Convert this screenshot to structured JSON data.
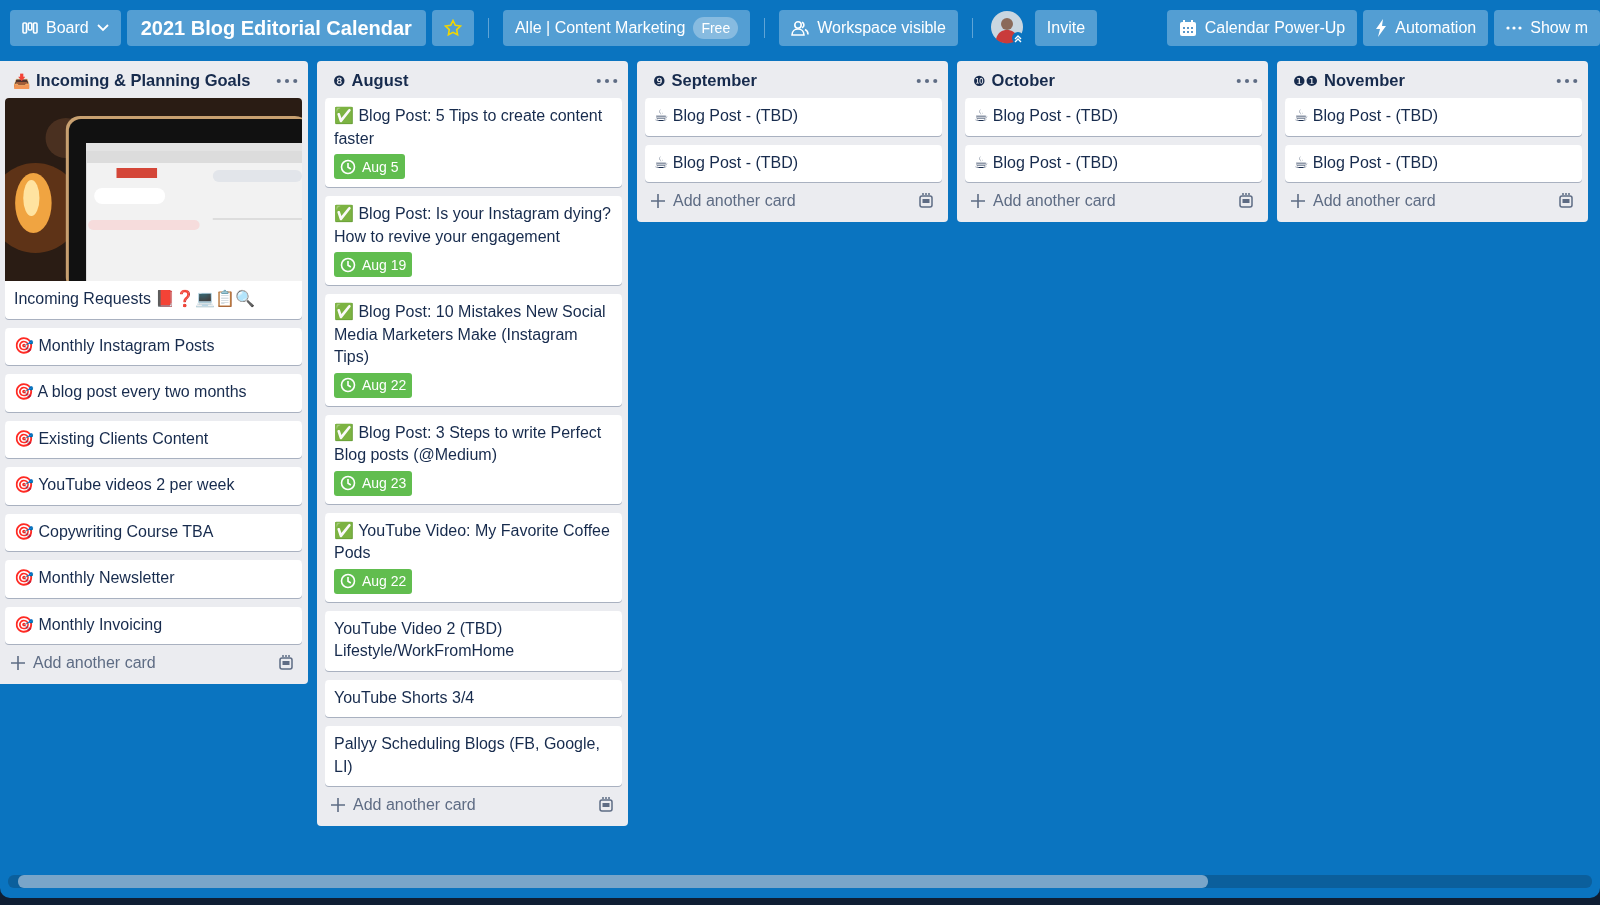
{
  "topbar": {
    "board_menu": "Board",
    "board_title": "2021 Blog Editorial Calendar",
    "starred": true,
    "workspace": "Alle | Content Marketing",
    "plan_badge": "Free",
    "visibility": "Workspace visible",
    "invite": "Invite",
    "actions": [
      {
        "kind": "calendar",
        "label": "Calendar Power-Up"
      },
      {
        "kind": "automation",
        "label": "Automation"
      },
      {
        "kind": "more",
        "label": "Show m"
      }
    ]
  },
  "lists": [
    {
      "mark": "📥",
      "title": "Incoming & Planning Goals",
      "add_card": "Add another card",
      "cards": [
        {
          "title": "Incoming Requests 📕❓💻📋🔍"
        },
        {
          "title": "🎯 Monthly Instagram Posts"
        },
        {
          "title": "🎯 A blog post every two months"
        },
        {
          "title": "🎯 Existing Clients Content"
        },
        {
          "title": "🎯 YouTube videos 2 per week"
        },
        {
          "title": "🎯 Copywriting Course TBA"
        },
        {
          "title": "🎯 Monthly Newsletter"
        },
        {
          "title": "🎯 Monthly Invoicing"
        }
      ]
    },
    {
      "mark": "❽",
      "title": "August",
      "add_card": "Add another card",
      "cards": [
        {
          "title": "✅ Blog Post: 5 Tips to create content faster",
          "due": {
            "date": "Aug 5",
            "complete": true
          }
        },
        {
          "title": "✅ Blog Post: Is your Instagram dying? How to revive your engagement",
          "due": {
            "date": "Aug 19",
            "complete": true
          }
        },
        {
          "title": "✅ Blog Post: 10 Mistakes New Social Media Marketers Make (Instagram Tips)",
          "due": {
            "date": "Aug 22",
            "complete": true
          }
        },
        {
          "title": "✅ Blog Post: 3 Steps to write Perfect Blog posts (@Medium)",
          "due": {
            "date": "Aug 23",
            "complete": true
          }
        },
        {
          "title": "✅ YouTube Video: My Favorite Coffee Pods",
          "due": {
            "date": "Aug 22",
            "complete": true
          }
        },
        {
          "title": "YouTube Video 2 (TBD) Lifestyle/WorkFromHome"
        },
        {
          "title": "YouTube Shorts 3/4"
        },
        {
          "title": "Pallyy Scheduling Blogs (FB, Google, LI)"
        }
      ]
    },
    {
      "mark": "❾",
      "title": "September",
      "add_card": "Add another card",
      "cards": [
        {
          "title": "☕ Blog Post - (TBD)"
        },
        {
          "title": "☕ Blog Post - (TBD)"
        }
      ]
    },
    {
      "mark": "❿",
      "title": "October",
      "add_card": "Add another card",
      "cards": [
        {
          "title": "☕ Blog Post - (TBD)"
        },
        {
          "title": "☕ Blog Post - (TBD)"
        }
      ]
    },
    {
      "mark": "❶❶",
      "title": "November",
      "add_card": "Add another card",
      "cards": [
        {
          "title": "☕ Blog Post - (TBD)"
        },
        {
          "title": "☕ Blog Post - (TBD)"
        }
      ]
    }
  ]
}
